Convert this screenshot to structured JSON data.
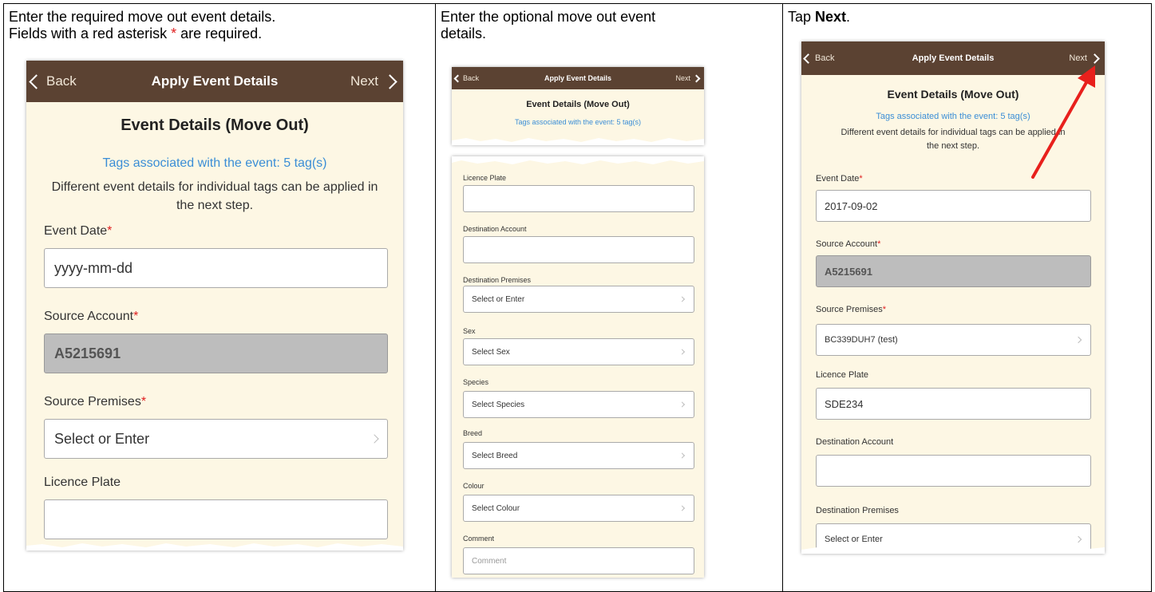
{
  "instructions": {
    "col1_line1": "Enter the required move out event details.",
    "col1_line2_pre": "Fields with a red asterisk ",
    "col1_star": "*",
    "col1_line2_post": " are required.",
    "col2_line1": "Enter the optional move out event",
    "col2_line2": "details.",
    "col3_pre": "Tap ",
    "col3_bold": "Next",
    "col3_post": "."
  },
  "nav": {
    "back": "Back",
    "title": "Apply Event Details",
    "next": "Next"
  },
  "section_title": "Event Details (Move Out)",
  "tags_text": "Tags associated with the event: 5 tag(s)",
  "note_line1": "Different event details for individual tags can be applied in",
  "note_line2": "the next step.",
  "required_star": "*",
  "phone1": {
    "event_date_label": "Event Date",
    "event_date_placeholder": "yyyy-mm-dd",
    "source_account_label": "Source Account",
    "source_account_value": "A5215691",
    "source_premises_label": "Source Premises",
    "source_premises_placeholder": "Select or Enter",
    "licence_plate_label": "Licence Plate"
  },
  "phone2": {
    "licence_plate_label": "Licence Plate",
    "destination_account_label": "Destination Account",
    "destination_premises_label": "Destination Premises",
    "destination_premises_placeholder": "Select or Enter",
    "sex_label": "Sex",
    "sex_placeholder": "Select Sex",
    "species_label": "Species",
    "species_placeholder": "Select Species",
    "breed_label": "Breed",
    "breed_placeholder": "Select Breed",
    "colour_label": "Colour",
    "colour_placeholder": "Select Colour",
    "comment_label": "Comment",
    "comment_placeholder": "Comment"
  },
  "phone3": {
    "event_date_label": "Event Date",
    "event_date_value": "2017-09-02",
    "source_account_label": "Source Account",
    "source_account_value": "A5215691",
    "source_premises_label": "Source Premises",
    "source_premises_value": "BC339DUH7 (test)",
    "licence_plate_label": "Licence Plate",
    "licence_plate_value": "SDE234",
    "destination_account_label": "Destination Account",
    "destination_premises_label": "Destination Premises",
    "destination_premises_placeholder": "Select or Enter"
  },
  "colors": {
    "nav_bg": "#5b4232",
    "screen_bg": "#fdf7e4",
    "link_blue": "#3b8ed6",
    "required_red": "#e02020",
    "annotation_arrow": "#e8201c"
  }
}
